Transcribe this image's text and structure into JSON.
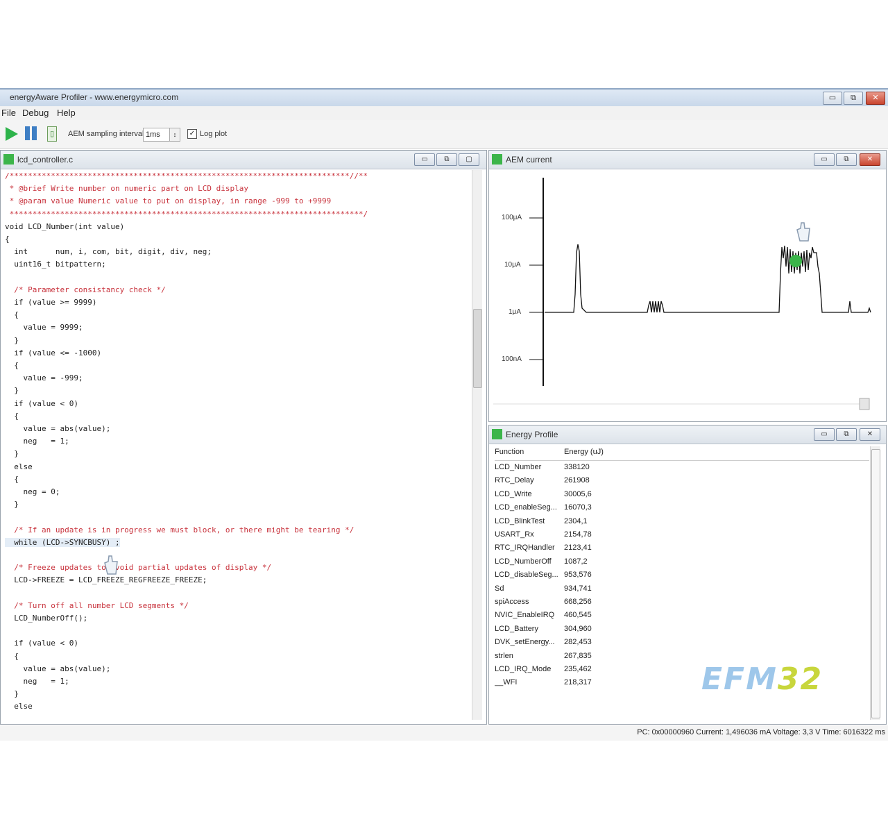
{
  "window": {
    "title": "energyAware Profiler - www.energymicro.com",
    "buttons": {
      "minimize": "▭",
      "maximize": "⧉",
      "close": "✕"
    }
  },
  "menu": {
    "items": [
      "File",
      "Debug",
      "Help"
    ]
  },
  "toolbar": {
    "sampling_label": "AEM sampling interval",
    "sampling_value": "1ms",
    "logplot_label": "Log plot",
    "logplot_checked": "✓"
  },
  "code_panel": {
    "title": "lcd_controller.c",
    "lines": [
      {
        "text": "/**************************************************************************//**",
        "style": "comment"
      },
      {
        "text": " * @brief Write number on numeric part on LCD display",
        "style": "comment"
      },
      {
        "text": " * @param value Numeric value to put on display, in range -999 to +9999",
        "style": "comment"
      },
      {
        "text": " *****************************************************************************/",
        "style": "comment"
      },
      {
        "text": "void LCD_Number(int value)",
        "style": "code"
      },
      {
        "text": "{",
        "style": "code"
      },
      {
        "text": "  int      num, i, com, bit, digit, div, neg;",
        "style": "code"
      },
      {
        "text": "  uint16_t bitpattern;",
        "style": "code"
      },
      {
        "text": "",
        "style": "code"
      },
      {
        "text": "  /* Parameter consistancy check */",
        "style": "comment"
      },
      {
        "text": "  if (value >= 9999)",
        "style": "code"
      },
      {
        "text": "  {",
        "style": "code"
      },
      {
        "text": "    value = 9999;",
        "style": "code"
      },
      {
        "text": "  }",
        "style": "code"
      },
      {
        "text": "  if (value <= -1000)",
        "style": "code"
      },
      {
        "text": "  {",
        "style": "code"
      },
      {
        "text": "    value = -999;",
        "style": "code"
      },
      {
        "text": "  }",
        "style": "code"
      },
      {
        "text": "  if (value < 0)",
        "style": "code"
      },
      {
        "text": "  {",
        "style": "code"
      },
      {
        "text": "    value = abs(value);",
        "style": "code"
      },
      {
        "text": "    neg   = 1;",
        "style": "code"
      },
      {
        "text": "  }",
        "style": "code"
      },
      {
        "text": "  else",
        "style": "code"
      },
      {
        "text": "  {",
        "style": "code"
      },
      {
        "text": "    neg = 0;",
        "style": "code"
      },
      {
        "text": "  }",
        "style": "code"
      },
      {
        "text": "",
        "style": "code"
      },
      {
        "text": "  /* If an update is in progress we must block, or there might be tearing */",
        "style": "comment"
      },
      {
        "text": "  while (LCD->SYNCBUSY) ;",
        "style": "highlight"
      },
      {
        "text": "",
        "style": "code"
      },
      {
        "text": "  /* Freeze updates to avoid partial updates of display */",
        "style": "comment"
      },
      {
        "text": "  LCD->FREEZE = LCD_FREEZE_REGFREEZE_FREEZE;",
        "style": "code"
      },
      {
        "text": "",
        "style": "code"
      },
      {
        "text": "  /* Turn off all number LCD segments */",
        "style": "comment"
      },
      {
        "text": "  LCD_NumberOff();",
        "style": "code"
      },
      {
        "text": "",
        "style": "code"
      },
      {
        "text": "  if (value < 0)",
        "style": "code"
      },
      {
        "text": "  {",
        "style": "code"
      },
      {
        "text": "    value = abs(value);",
        "style": "code"
      },
      {
        "text": "    neg   = 1;",
        "style": "code"
      },
      {
        "text": "  }",
        "style": "code"
      },
      {
        "text": "  else",
        "style": "code"
      }
    ]
  },
  "aem_panel": {
    "title": "AEM current",
    "y_ticks": [
      "100μA",
      "10μA",
      "1μA",
      "100nA"
    ]
  },
  "energy_panel": {
    "title": "Energy Profile",
    "columns": [
      "Function",
      "Energy (uJ)"
    ],
    "rows": [
      [
        "LCD_Number",
        "338120"
      ],
      [
        "RTC_Delay",
        "261908"
      ],
      [
        "LCD_Write",
        "30005,6"
      ],
      [
        "LCD_enableSeg...",
        "16070,3"
      ],
      [
        "LCD_BlinkTest",
        "2304,1"
      ],
      [
        "USART_Rx",
        "2154,78"
      ],
      [
        "RTC_IRQHandler",
        "2123,41"
      ],
      [
        "LCD_NumberOff",
        "1087,2"
      ],
      [
        "LCD_disableSeg...",
        "953,576"
      ],
      [
        "Sd",
        "934,741"
      ],
      [
        "spiAccess",
        "668,256"
      ],
      [
        "NVIC_EnableIRQ",
        "460,545"
      ],
      [
        "LCD_Battery",
        "304,960"
      ],
      [
        "DVK_setEnergy...",
        "282,453"
      ],
      [
        "strlen",
        "267,835"
      ],
      [
        "LCD_IRQ_Mode",
        "235,462"
      ],
      [
        "__WFI",
        "218,317"
      ]
    ],
    "logo_part1": "EFM",
    "logo_part2": "32",
    "logo_colors": {
      "efm": "#9ec7ea",
      "num": "#c8d63c"
    }
  },
  "status": {
    "text": "PC: 0x00000960  Current: 1,496036 mA  Voltage: 3,3 V  Time: 6016322 ms"
  },
  "colors": {
    "accent_green": "#3cb54a",
    "comment_red": "#c8323c",
    "window_blue": "#c9d8ea"
  }
}
